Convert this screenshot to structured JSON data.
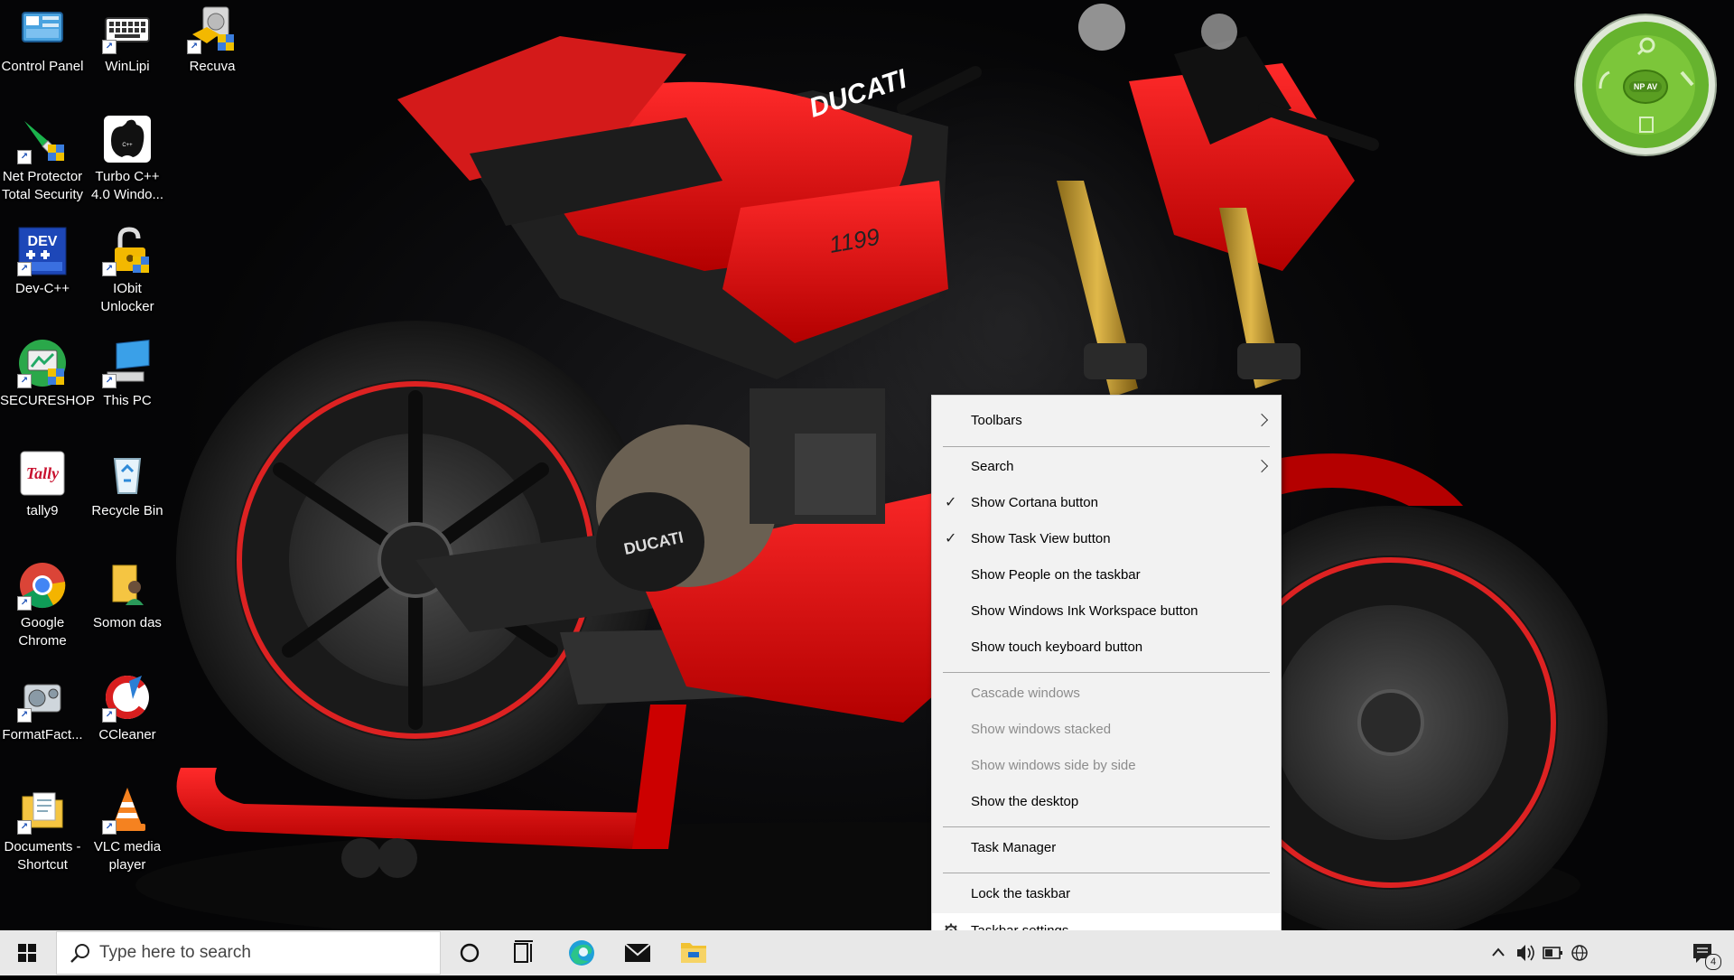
{
  "desktop_icons": [
    {
      "label": "Control Panel",
      "icon": "control-panel-icon",
      "name": "control-panel"
    },
    {
      "label": "WinLipi",
      "icon": "keyboard-icon",
      "name": "winlipi"
    },
    {
      "label": "Recuva",
      "icon": "recuva-icon",
      "name": "recuva"
    },
    {
      "label": "Net Protector Total Security",
      "icon": "net-protector-icon",
      "name": "net-protector"
    },
    {
      "label": "Turbo C++ 4.0 Windo...",
      "icon": "turbo-cpp-icon",
      "name": "turbo-cpp"
    },
    {
      "label": "Dev-C++",
      "icon": "dev-cpp-icon",
      "name": "dev-cpp"
    },
    {
      "label": "IObit Unlocker",
      "icon": "lock-icon",
      "name": "iobit-unlocker"
    },
    {
      "label": "SECURESHOP",
      "icon": "secureshop-icon",
      "name": "secureshop"
    },
    {
      "label": "This PC",
      "icon": "computer-icon",
      "name": "this-pc"
    },
    {
      "label": "tally9",
      "icon": "tally-icon",
      "name": "tally9"
    },
    {
      "label": "Recycle Bin",
      "icon": "recycle-bin-icon",
      "name": "recycle-bin"
    },
    {
      "label": "Google Chrome",
      "icon": "chrome-icon",
      "name": "google-chrome"
    },
    {
      "label": "Somon das",
      "icon": "user-folder-icon",
      "name": "somon-das"
    },
    {
      "label": "FormatFact...",
      "icon": "format-factory-icon",
      "name": "format-factory"
    },
    {
      "label": "CCleaner",
      "icon": "ccleaner-icon",
      "name": "ccleaner"
    },
    {
      "label": "Documents - Shortcut",
      "icon": "documents-folder-icon",
      "name": "documents-shortcut"
    },
    {
      "label": "VLC media player",
      "icon": "vlc-icon",
      "name": "vlc-media-player"
    }
  ],
  "wallpaper": {
    "badge": "DUCATI",
    "tank": "DUCATI",
    "model": "1199"
  },
  "gadget": {
    "badge": "NP AV"
  },
  "context_menu": {
    "items": [
      {
        "label": "Toolbars",
        "submenu": true,
        "checked": false,
        "disabled": false
      },
      {
        "label": "Search",
        "submenu": true,
        "checked": false,
        "disabled": false
      },
      {
        "label": "Show Cortana button",
        "submenu": false,
        "checked": true,
        "disabled": false
      },
      {
        "label": "Show Task View button",
        "submenu": false,
        "checked": true,
        "disabled": false
      },
      {
        "label": "Show People on the taskbar",
        "submenu": false,
        "checked": false,
        "disabled": false
      },
      {
        "label": "Show Windows Ink Workspace button",
        "submenu": false,
        "checked": false,
        "disabled": false
      },
      {
        "label": "Show touch keyboard button",
        "submenu": false,
        "checked": false,
        "disabled": false
      },
      {
        "label": "Cascade windows",
        "submenu": false,
        "checked": false,
        "disabled": true
      },
      {
        "label": "Show windows stacked",
        "submenu": false,
        "checked": false,
        "disabled": true
      },
      {
        "label": "Show windows side by side",
        "submenu": false,
        "checked": false,
        "disabled": true
      },
      {
        "label": "Show the desktop",
        "submenu": false,
        "checked": false,
        "disabled": false
      },
      {
        "label": "Task Manager",
        "submenu": false,
        "checked": false,
        "disabled": false
      },
      {
        "label": "Lock the taskbar",
        "submenu": false,
        "checked": false,
        "disabled": false
      },
      {
        "label": "Taskbar settings",
        "submenu": false,
        "checked": false,
        "disabled": false,
        "icon": "gear-icon",
        "highlighted": true
      }
    ],
    "check_glyph": "✓"
  },
  "taskbar": {
    "search_placeholder": "Type here to search",
    "pinned": [
      "cortana-icon",
      "task-view-icon",
      "edge-icon",
      "mail-icon",
      "file-explorer-icon"
    ],
    "tray": [
      "chevron-up-icon",
      "speaker-icon",
      "battery-icon",
      "language-globe-icon"
    ],
    "notification_count": "4"
  },
  "colors": {
    "accent_red": "#e0101a",
    "menu_bg": "#f2f2f2",
    "taskbar_bg": "#e8e8e8",
    "disabled_text": "#8c8c8c"
  }
}
